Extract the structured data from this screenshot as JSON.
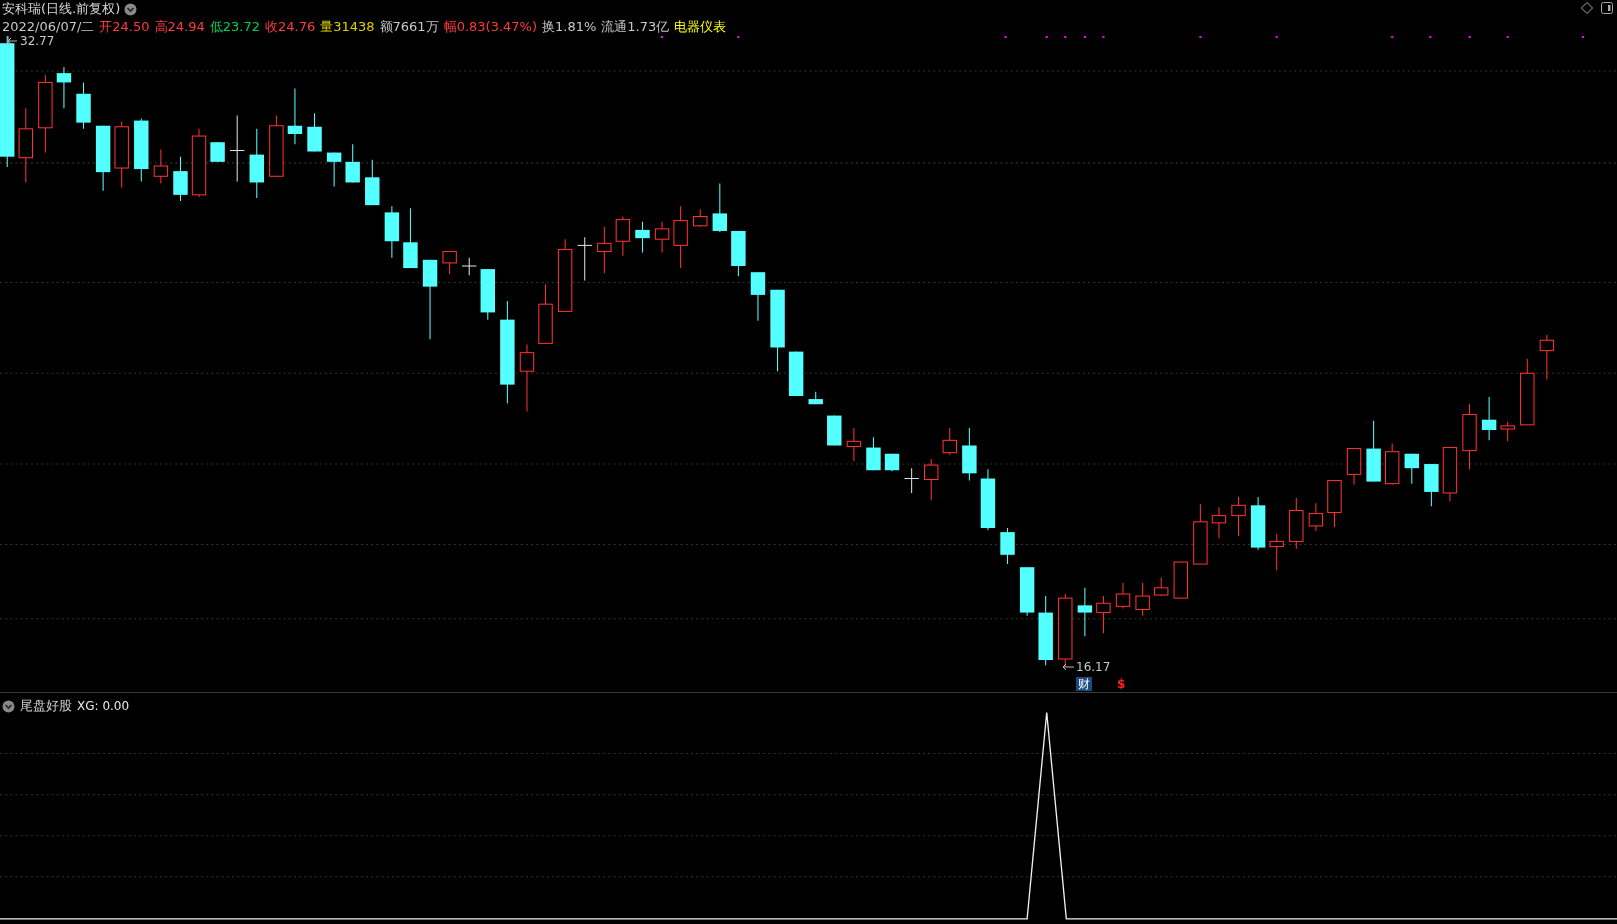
{
  "title": {
    "name": "安科瑞",
    "period": "(日线.前复权)"
  },
  "quote": [
    {
      "text": "2022/06/07/二",
      "color": "#c8c8c8"
    },
    {
      "text": "开24.50",
      "color": "#ff3b3b"
    },
    {
      "text": "高24.94",
      "color": "#ff3b3b"
    },
    {
      "text": "低23.72",
      "color": "#00d050"
    },
    {
      "text": "收24.76",
      "color": "#ff3b3b"
    },
    {
      "text": "量31438",
      "color": "#e0d000"
    },
    {
      "text": "额7661万",
      "color": "#c8c8c8"
    },
    {
      "text": "幅0.83(3.47%)",
      "color": "#ff3b3b"
    },
    {
      "text": "换1.81%",
      "color": "#c8c8c8"
    },
    {
      "text": "流通1.73亿",
      "color": "#c8c8c8"
    },
    {
      "text": "电器仪表",
      "color": "#ffff00"
    }
  ],
  "chart": {
    "high_label": "32.77",
    "low_label": "16.17",
    "badges": [
      {
        "kind": "finance",
        "text": "财"
      },
      {
        "kind": "dividend",
        "text": "$"
      }
    ]
  },
  "indicator": {
    "name": "尾盘好股",
    "reading": "XG: 0.00"
  }
}
